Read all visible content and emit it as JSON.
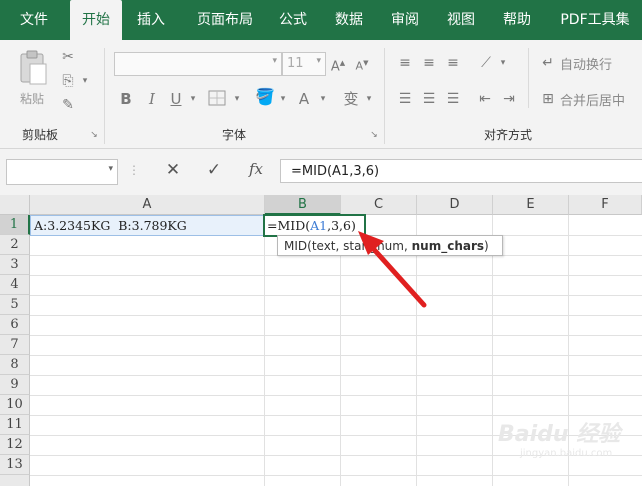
{
  "tabs": [
    {
      "label": "文件"
    },
    {
      "label": "开始"
    },
    {
      "label": "插入"
    },
    {
      "label": "页面布局"
    },
    {
      "label": "公式"
    },
    {
      "label": "数据"
    },
    {
      "label": "审阅"
    },
    {
      "label": "视图"
    },
    {
      "label": "帮助"
    },
    {
      "label": "PDF工具集"
    }
  ],
  "active_tab": "开始",
  "ribbon": {
    "clipboard": {
      "paste_label": "粘贴",
      "group_label": "剪贴板"
    },
    "font": {
      "font_size": "11",
      "bold": "B",
      "italic": "I",
      "underline": "U",
      "group_label": "字体"
    },
    "alignment": {
      "wrap_text": "自动换行",
      "merge_center": "合并后居中",
      "group_label": "对齐方式"
    }
  },
  "formula_bar": {
    "namebox": "",
    "fx": "fx",
    "formula": "=MID(A1,3,6)"
  },
  "columns": [
    "A",
    "B",
    "C",
    "D",
    "E",
    "F"
  ],
  "rows": [
    "1",
    "2",
    "3",
    "4",
    "5",
    "6",
    "7",
    "8",
    "9",
    "10",
    "11",
    "12",
    "13"
  ],
  "cells": {
    "A1": "A:3.2345KG  B:3.789KG",
    "B1_prefix": "=MID(",
    "B1_ref": "A1",
    "B1_suffix": ",3,6)"
  },
  "tooltip": {
    "text": "MID(text, start_num, ",
    "bold": "num_chars",
    "close": ")"
  },
  "watermark": {
    "brand": "Baidu 经验",
    "sub": "jingyan.baidu.com"
  },
  "colors": {
    "accent": "#217346",
    "arrow": "#e02020",
    "ref": "#3b7bd4"
  }
}
